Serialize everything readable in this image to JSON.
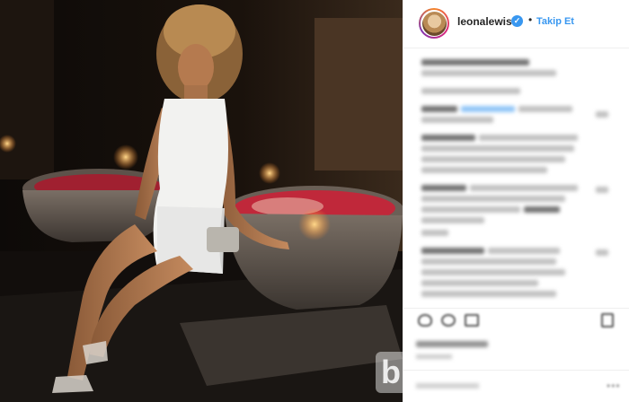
{
  "post": {
    "username": "leonalewis",
    "verified_icon": "checkmark-icon",
    "separator": "•",
    "follow_label": "Takip Et",
    "watermark_letter": "b"
  },
  "colors": {
    "accent": "#3897f0",
    "text": "#262626",
    "border": "#efefef"
  }
}
